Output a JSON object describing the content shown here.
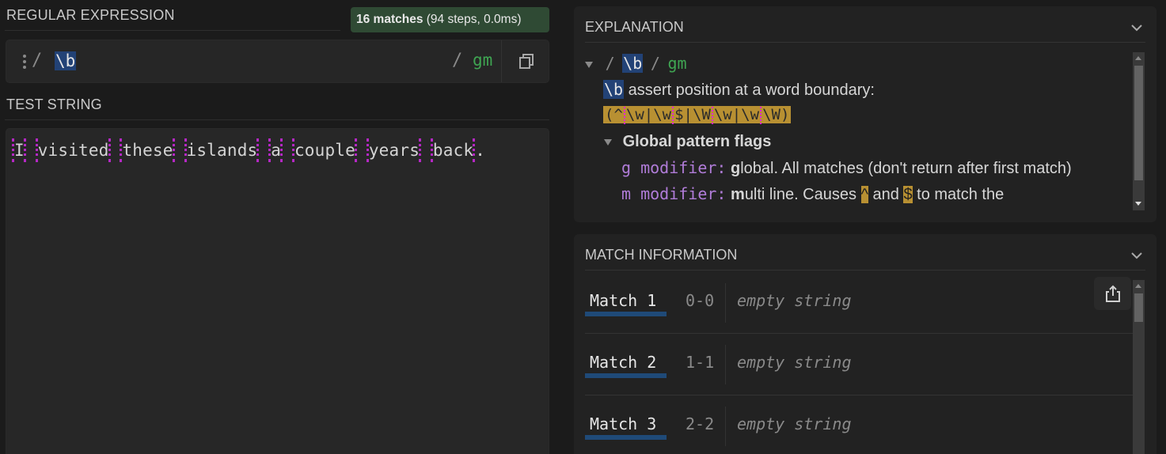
{
  "regex_section": {
    "title": "REGULAR EXPRESSION",
    "match_summary": {
      "count": "16 matches",
      "detail": "(94 steps, 0.0ms)"
    },
    "delimiter_open": "/",
    "pattern": "\\b",
    "delimiter_close": "/",
    "flags": "gm",
    "copy_icon": "copy-icon"
  },
  "test_section": {
    "title": "TEST STRING",
    "words": [
      "I",
      "visited",
      "these",
      "islands",
      "a",
      "couple",
      "years",
      "back"
    ],
    "trailing": ".",
    "boundary_color": "#b528c4"
  },
  "explanation": {
    "title": "EXPLANATION",
    "root": {
      "open": "/",
      "pattern": "\\b",
      "close": "/",
      "flags": "gm"
    },
    "token": "\\b",
    "token_desc": "assert position at a word boundary:",
    "equivalent_parts": [
      "(^",
      "\\w|\\w",
      "$|\\W",
      "\\w|\\w",
      "\\W)"
    ],
    "flags_heading": "Global pattern flags",
    "flag_items": [
      {
        "mod": "g modifier:",
        "lead": "g",
        "rest": "lobal. All matches (don't return after first match)"
      },
      {
        "mod": "m modifier:",
        "lead": "m",
        "rest_a": "ulti line. Causes",
        "caret": "^",
        "and": "and",
        "dollar": "$",
        "rest_b": "to match the"
      }
    ]
  },
  "match_info": {
    "title": "MATCH INFORMATION",
    "matches": [
      {
        "label": "Match 1",
        "range": "0-0",
        "value": "empty string"
      },
      {
        "label": "Match 2",
        "range": "1-1",
        "value": "empty string"
      },
      {
        "label": "Match 3",
        "range": "2-2",
        "value": "empty string"
      }
    ],
    "share_icon": "share-export-icon"
  },
  "colors": {
    "background": "#1b1b1b",
    "panel": "#222222",
    "token_highlight": "#224276",
    "flag_green": "#3fa552",
    "gold": "#b89032",
    "modifier_purple": "#b07cd8",
    "match_underline": "#1f4a78",
    "badge_green": "#2f4a34"
  }
}
